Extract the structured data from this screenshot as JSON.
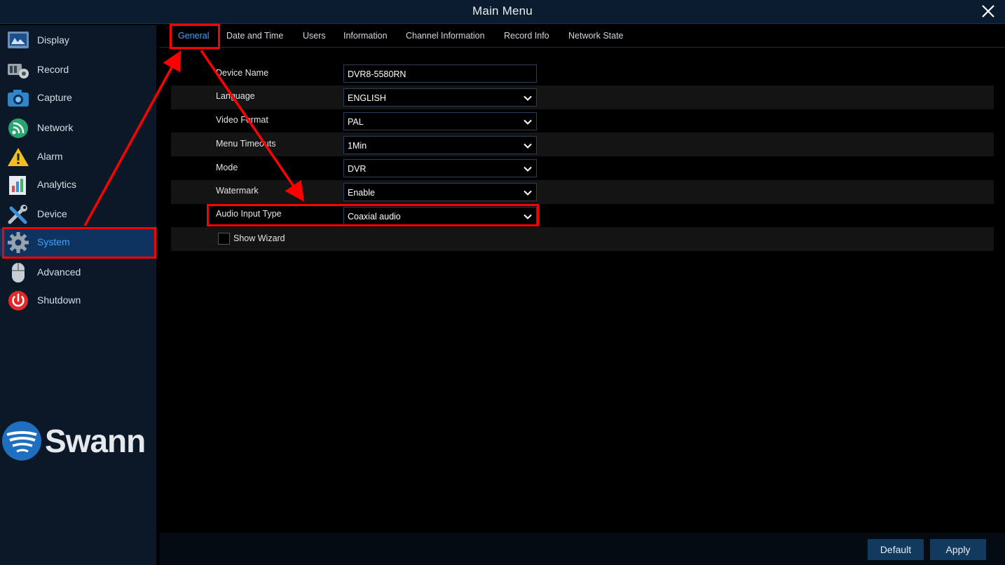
{
  "window": {
    "title": "Main Menu",
    "close_icon": "close-icon"
  },
  "sidebar": {
    "items": [
      {
        "label": "Display",
        "icon": "display-icon"
      },
      {
        "label": "Record",
        "icon": "record-icon"
      },
      {
        "label": "Capture",
        "icon": "camera-icon"
      },
      {
        "label": "Network",
        "icon": "network-icon"
      },
      {
        "label": "Alarm",
        "icon": "alarm-icon"
      },
      {
        "label": "Analytics",
        "icon": "analytics-icon"
      },
      {
        "label": "Device",
        "icon": "device-icon"
      },
      {
        "label": "System",
        "icon": "gear-icon",
        "active": true
      },
      {
        "label": "Advanced",
        "icon": "mouse-icon"
      },
      {
        "label": "Shutdown",
        "icon": "power-icon"
      }
    ],
    "logo": {
      "text": "Swann",
      "icon": "swann-logo-icon"
    }
  },
  "tabs": [
    {
      "label": "General",
      "active": true
    },
    {
      "label": "Date and Time"
    },
    {
      "label": "Users"
    },
    {
      "label": "Information"
    },
    {
      "label": "Channel Information"
    },
    {
      "label": "Record Info"
    },
    {
      "label": "Network State"
    }
  ],
  "form": {
    "device_name": {
      "label": "Device Name",
      "value": "DVR8-5580RN"
    },
    "language": {
      "label": "Language",
      "value": "ENGLISH"
    },
    "video_format": {
      "label": "Video Format",
      "value": "PAL"
    },
    "menu_timeouts": {
      "label": "Menu Timeouts",
      "value": "1Min"
    },
    "mode": {
      "label": "Mode",
      "value": "DVR"
    },
    "watermark": {
      "label": "Watermark",
      "value": "Enable"
    },
    "audio_input_type": {
      "label": "Audio Input Type",
      "value": "Coaxial audio"
    },
    "show_wizard": {
      "label": "Show Wizard",
      "checked": false
    }
  },
  "buttons": {
    "default_label": "Default",
    "apply_label": "Apply"
  },
  "colors": {
    "accent": "#3ea3ff",
    "highlight": "#ff0000",
    "sidebar_active": "#0d3460",
    "button": "#12395e"
  }
}
